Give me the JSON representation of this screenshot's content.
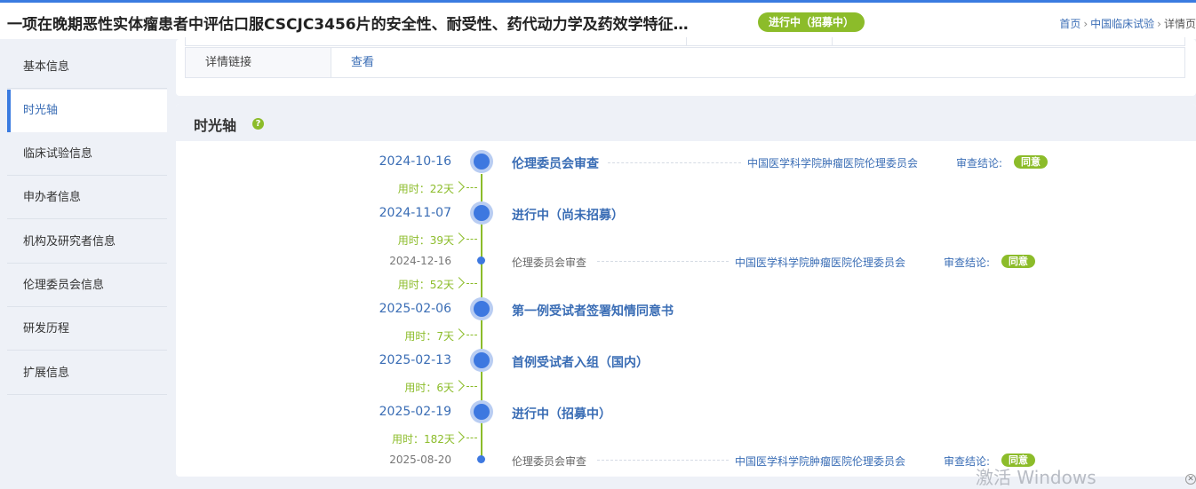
{
  "header": {
    "title": "一项在晚期恶性实体瘤患者中评估口服CSCJC3456片的安全性、耐受性、药代动力学及药效学特征…",
    "status": "进行中（招募中）",
    "breadcrumb": [
      "首页",
      "中国临床试验",
      "详情页"
    ]
  },
  "sidebar": {
    "items": [
      {
        "label": "基本信息"
      },
      {
        "label": "时光轴"
      },
      {
        "label": "临床试验信息"
      },
      {
        "label": "申办者信息"
      },
      {
        "label": "机构及研究者信息"
      },
      {
        "label": "伦理委员会信息"
      },
      {
        "label": "研发历程"
      },
      {
        "label": "扩展信息"
      }
    ],
    "active_index": 1
  },
  "detail_table": {
    "label": "详情链接",
    "link": "查看"
  },
  "timeline": {
    "title": "时光轴",
    "help_icon": "?",
    "verdict_label": "审查结论:",
    "events": [
      {
        "date": "2024-10-16",
        "title": "伦理委员会审查",
        "org": "中国医学科学院肿瘤医院伦理委员会",
        "verdict": "同意",
        "major": true
      },
      {
        "duration": "用时：22天"
      },
      {
        "date": "2024-11-07",
        "title": "进行中（尚未招募）",
        "major": true
      },
      {
        "duration": "用时：39天"
      },
      {
        "date": "2024-12-16",
        "title": "伦理委员会审查",
        "org": "中国医学科学院肿瘤医院伦理委员会",
        "verdict": "同意",
        "major": false
      },
      {
        "duration": "用时：52天"
      },
      {
        "date": "2025-02-06",
        "title": "第一例受试者签署知情同意书",
        "major": true
      },
      {
        "duration": "用时：7天"
      },
      {
        "date": "2025-02-13",
        "title": "首例受试者入组（国内）",
        "major": true
      },
      {
        "duration": "用时：6天"
      },
      {
        "date": "2025-02-19",
        "title": "进行中（招募中）",
        "major": true
      },
      {
        "duration": "用时：182天"
      },
      {
        "date": "2025-08-20",
        "title": "伦理委员会审查",
        "org": "中国医学科学院肿瘤医院伦理委员会",
        "verdict": "同意",
        "major": false
      }
    ]
  },
  "watermark": "激活 Windows",
  "colors": {
    "accent": "#3a7be0",
    "green": "#8cbc2a",
    "link": "#3a6db5"
  }
}
